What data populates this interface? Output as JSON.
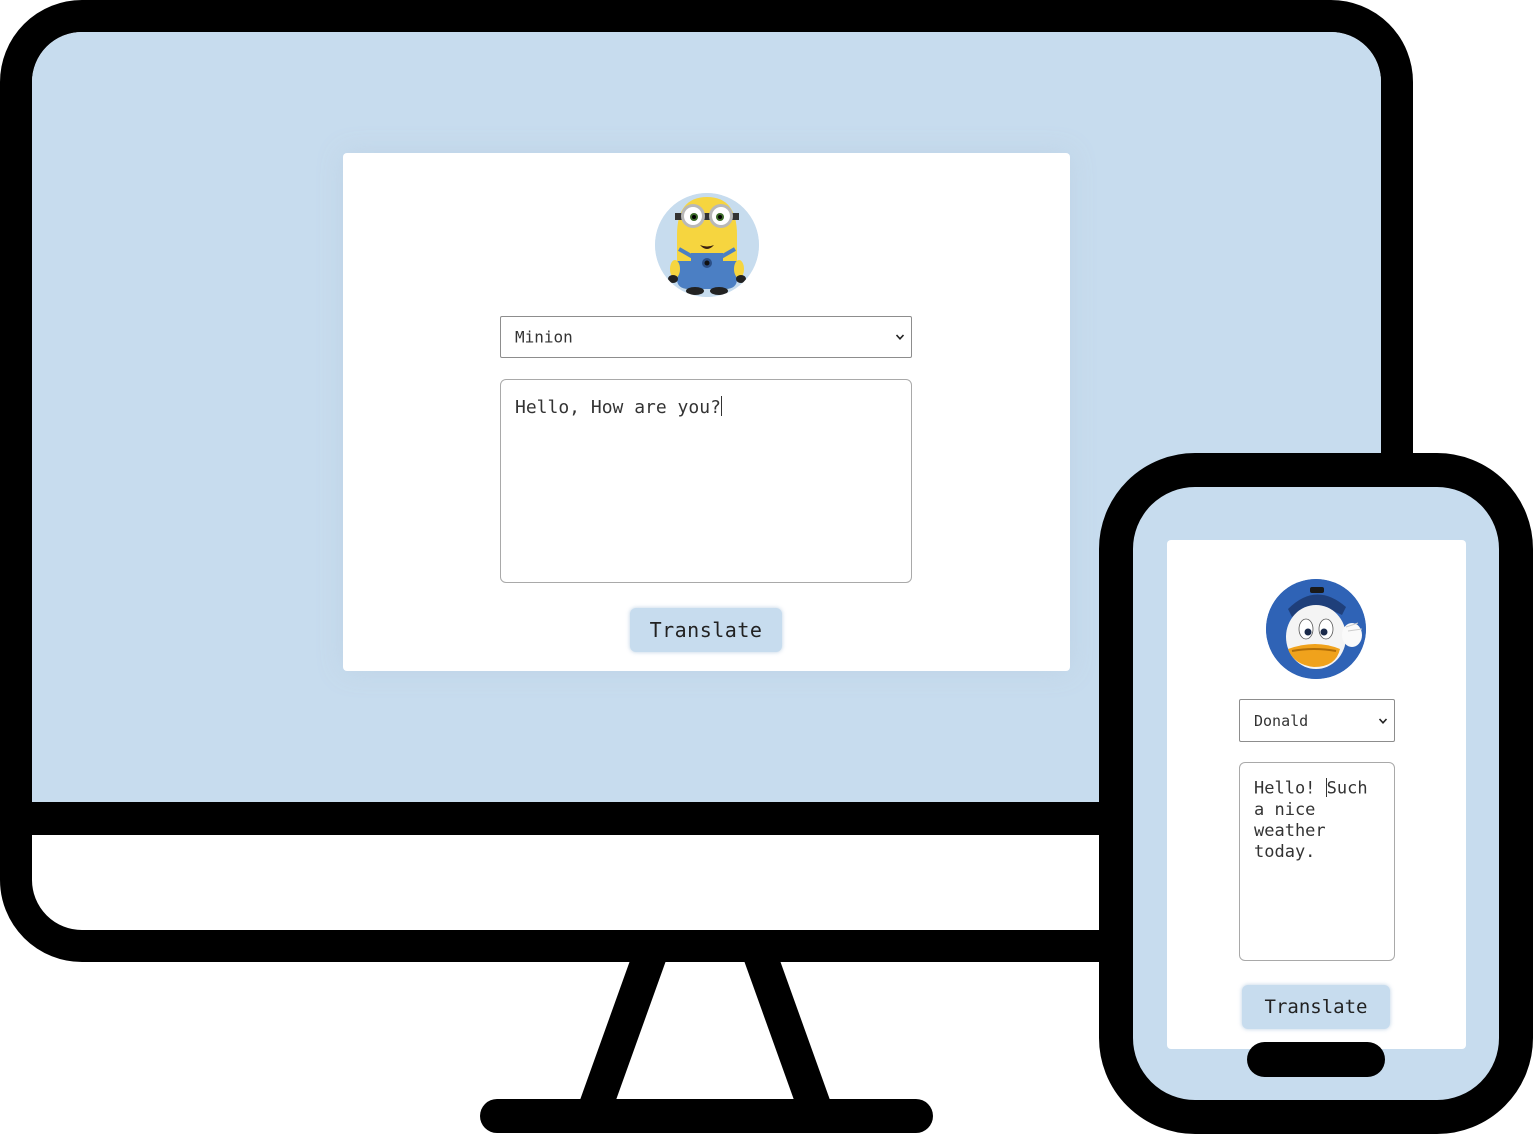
{
  "desktop": {
    "character": "Minion",
    "input_text": "Hello, How are you?",
    "button_label": "Translate"
  },
  "phone": {
    "character": "Donald",
    "input_text_before_caret": "Hello! ",
    "input_text_after_caret": "Such a nice weather today.",
    "button_label": "Translate"
  },
  "colors": {
    "screen_bg": "#c7dcee",
    "frame": "#000000",
    "card": "#ffffff",
    "button_bg": "#c7dcee"
  }
}
